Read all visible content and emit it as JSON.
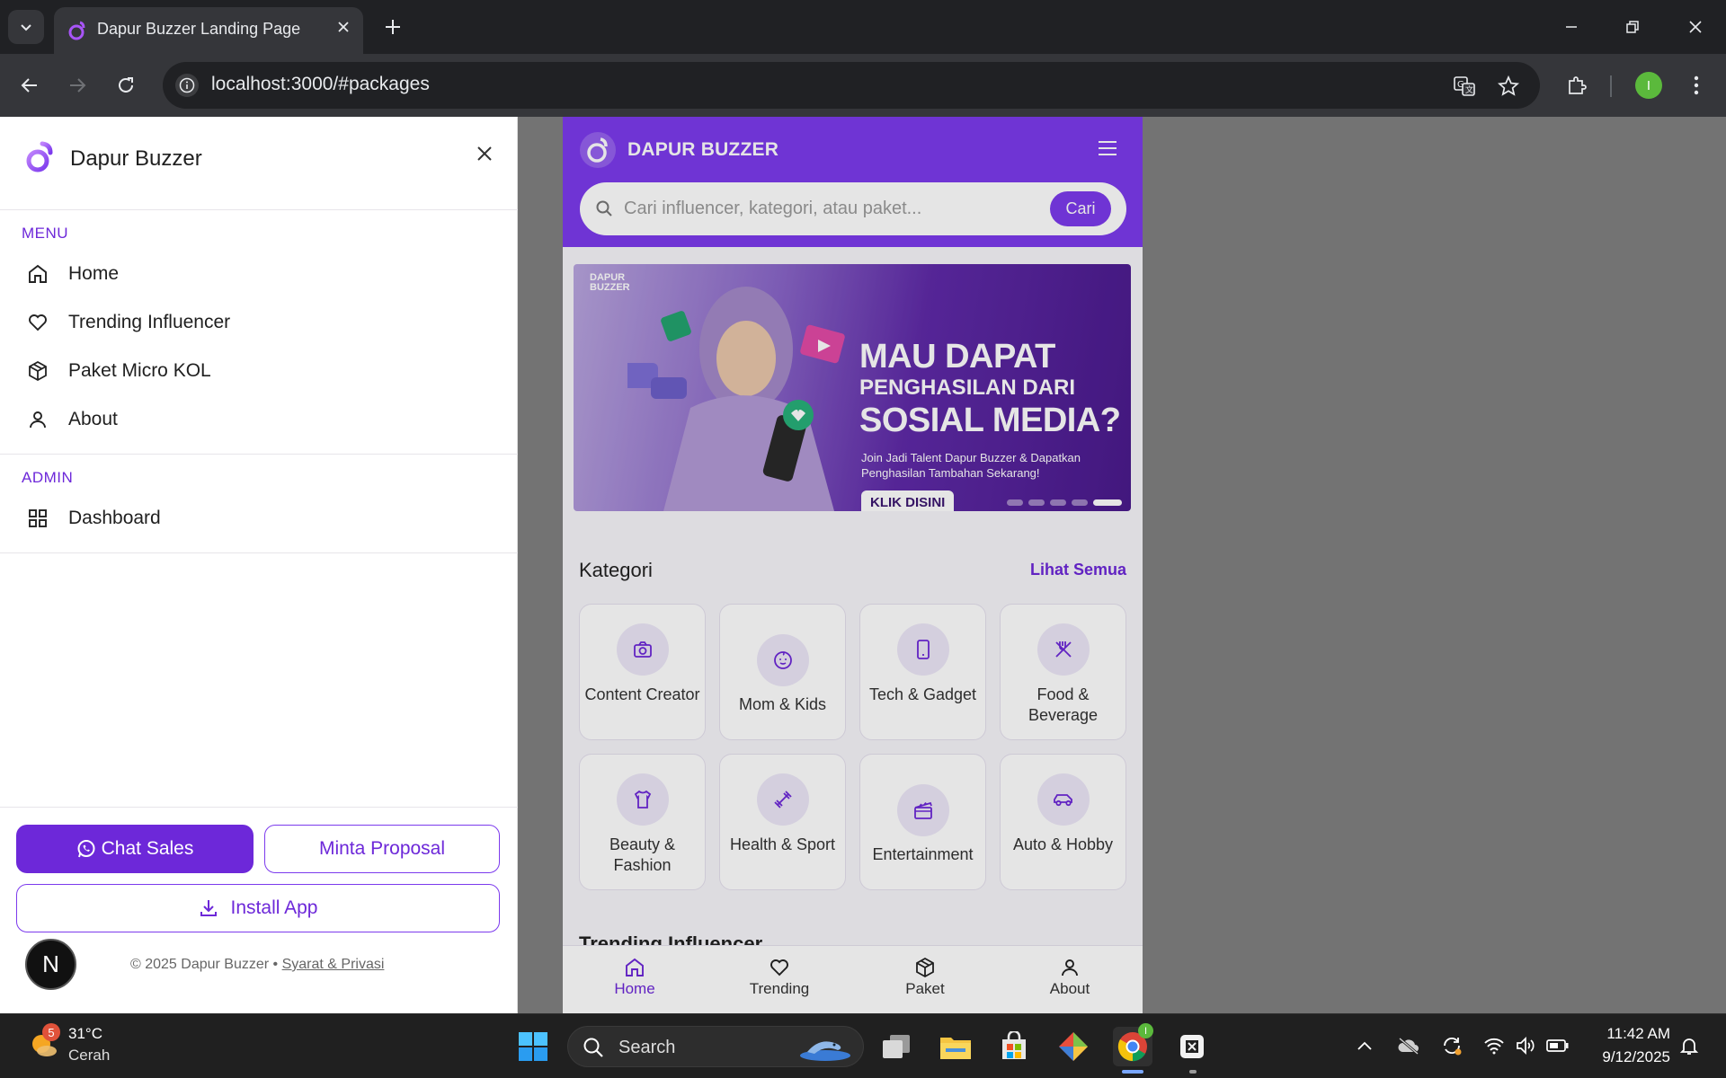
{
  "browser": {
    "tab_title": "Dapur Buzzer Landing Page",
    "url": "localhost:3000/#packages",
    "profile_initial": "I"
  },
  "app": {
    "brand": "DAPUR BUZZER",
    "search": {
      "placeholder": "Cari influencer, kategori, atau paket...",
      "button": "Cari"
    },
    "banner": {
      "logo_line1": "DAPUR",
      "logo_line2": "BUZZER",
      "headline1": "MAU DAPAT",
      "headline2": "PENGHASILAN DARI",
      "headline3": "SOSIAL MEDIA?",
      "subtext": "Join Jadi Talent Dapur Buzzer & Dapatkan Penghasilan Tambahan Sekarang!",
      "cta": "KLIK DISINI",
      "slides": 5,
      "active_slide": 5
    },
    "categories_section": {
      "title": "Kategori",
      "link": "Lihat Semua",
      "items": [
        {
          "label": "Content Creator",
          "icon": "camera-icon"
        },
        {
          "label": "Mom & Kids",
          "icon": "baby-icon"
        },
        {
          "label": "Tech & Gadget",
          "icon": "smartphone-icon"
        },
        {
          "label": "Food & Beverage",
          "icon": "utensils-icon"
        },
        {
          "label": "Beauty & Fashion",
          "icon": "shirt-icon"
        },
        {
          "label": "Health & Sport",
          "icon": "dumbbell-icon"
        },
        {
          "label": "Entertainment",
          "icon": "clapperboard-icon"
        },
        {
          "label": "Auto & Hobby",
          "icon": "car-icon"
        }
      ]
    },
    "trending_peek": "Trending Influencer",
    "bottom_nav": [
      {
        "label": "Home",
        "icon": "home-icon",
        "active": true
      },
      {
        "label": "Trending",
        "icon": "heart-icon",
        "active": false
      },
      {
        "label": "Paket",
        "icon": "package-icon",
        "active": false
      },
      {
        "label": "About",
        "icon": "user-icon",
        "active": false
      }
    ]
  },
  "drawer": {
    "title": "Dapur Buzzer",
    "menu_heading": "MENU",
    "menu_items": [
      {
        "label": "Home",
        "icon": "home-icon"
      },
      {
        "label": "Trending Influencer",
        "icon": "heart-icon"
      },
      {
        "label": "Paket Micro KOL",
        "icon": "package-icon"
      },
      {
        "label": "About",
        "icon": "user-icon"
      }
    ],
    "admin_heading": "ADMIN",
    "admin_items": [
      {
        "label": "Dashboard",
        "icon": "grid-icon"
      }
    ],
    "chat_sales": "Chat Sales",
    "minta_proposal": "Minta Proposal",
    "install_app": "Install App",
    "footer_copy": "© 2025 Dapur Buzzer •",
    "footer_link": "Syarat & Privasi",
    "next_badge": "N"
  },
  "taskbar": {
    "weather_temp": "31°C",
    "weather_desc": "Cerah",
    "weather_badge": "5",
    "search_label": "Search",
    "chrome_badge": "I",
    "time": "11:42 AM",
    "date": "9/12/2025"
  },
  "colors": {
    "brand_purple": "#7c3aed",
    "brand_purple_dark": "#6d28d9",
    "chrome_dark": "#202124",
    "chrome_toolbar": "#35363a"
  }
}
